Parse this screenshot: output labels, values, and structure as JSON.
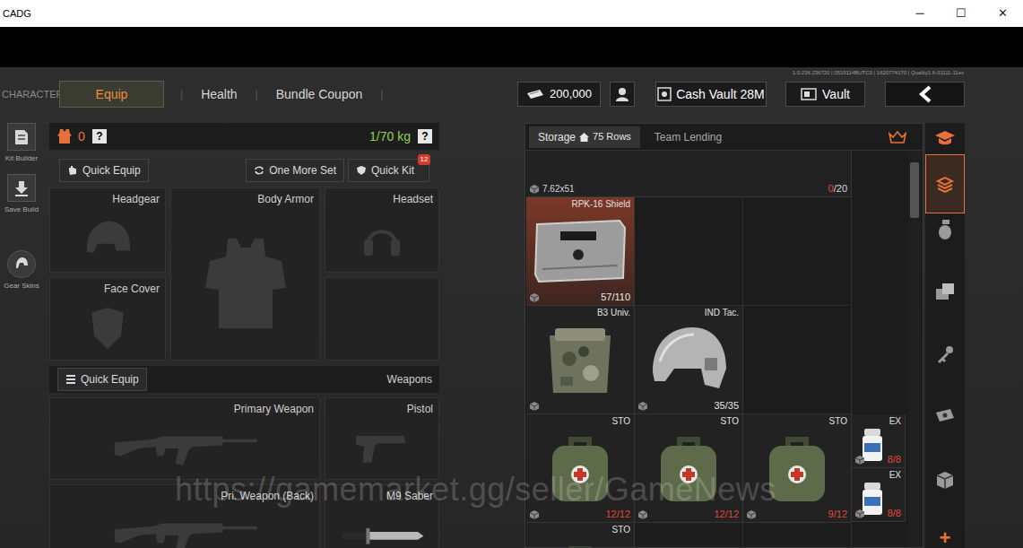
{
  "window": {
    "title": "CADG",
    "controls": [
      "─",
      "☐",
      "✕"
    ]
  },
  "build_info": "1.0.236.236720 | 0519114BUTC0 | 1620774170 | Quality1.6-01111-11ex",
  "nav": {
    "section": "CHARACTER",
    "separator": "|",
    "tabs": [
      {
        "label": "Equip",
        "selected": true
      },
      {
        "label": "Health",
        "selected": false
      },
      {
        "label": "Bundle Coupon",
        "selected": false
      }
    ]
  },
  "wallet": {
    "money": "200,000",
    "cash_vault": "Cash Vault 28M",
    "vault": "Vault"
  },
  "side_tools": [
    {
      "label": "Kit Builder",
      "kind": "kit"
    },
    {
      "label": "Save Build",
      "kind": "save"
    },
    {
      "label": "Gear Skins",
      "kind": "skins"
    }
  ],
  "loadout": {
    "armor_class": "0",
    "help": "?",
    "weight": "1/70 kg",
    "quick_equip": "Quick Equip",
    "one_more_set": "One More Set",
    "quick_kit": "Quick Kit",
    "quick_kit_badge": "12",
    "gear_slots": [
      {
        "label": "Headgear",
        "kind": "helmet"
      },
      {
        "label": "Body Armor",
        "kind": "armor"
      },
      {
        "label": "Headset",
        "kind": "headset"
      },
      {
        "label": "Face Cover",
        "kind": "face"
      }
    ],
    "weapons_quick_equip": "Quick Equip",
    "weapons_label": "Weapons",
    "weapon_slots": [
      {
        "label": "Primary Weapon",
        "kind": "rifle",
        "equipped": false
      },
      {
        "label": "Pistol",
        "kind": "pistol",
        "equipped": false
      },
      {
        "label": "Pri. Weapon (Back)",
        "kind": "rifle",
        "equipped": false
      },
      {
        "label": "M9 Saber",
        "kind": "knife",
        "equipped": true
      }
    ]
  },
  "storage": {
    "tabs": [
      {
        "label": "Storage",
        "count": "75 Rows",
        "selected": true
      },
      {
        "label": "Team Lending",
        "count": "",
        "selected": false
      }
    ],
    "scrollbar": {
      "offset": 0.03,
      "level": 0.14
    },
    "rows": [
      {
        "items": [
          {
            "label": "",
            "kind": "gun",
            "caliber": "7.62x51",
            "amount": "0",
            "capacity": "/20",
            "amount_color": "#e0483a",
            "capacity_color": "#d8d8d8",
            "slots": 3,
            "size": "large",
            "selected": false
          }
        ]
      },
      {
        "items": [
          {
            "label": "RPK-16 Shield",
            "kind": "shield",
            "caliber": "",
            "amount": "57",
            "capacity": "/110",
            "amount_color": "#e8e8e8",
            "capacity_color": "#e8e8e8",
            "slots": 1,
            "size": "large",
            "selected": true
          }
        ]
      },
      {
        "items": [
          {
            "label": "B3 Univ.",
            "kind": "pouch",
            "caliber": "",
            "amount": "",
            "capacity": "",
            "amount_color": "#e8e8e8",
            "capacity_color": "#e8e8e8",
            "slots": 1,
            "size": "large",
            "selected": false
          },
          {
            "label": "IND Tac.",
            "kind": "helmet",
            "caliber": "",
            "amount": "35",
            "capacity": "/35",
            "amount_color": "#e8e8e8",
            "capacity_color": "#e8e8e8",
            "slots": 1,
            "size": "large",
            "selected": false
          }
        ]
      },
      {
        "items": [
          {
            "label": "STO",
            "kind": "medbag",
            "caliber": "",
            "amount": "12",
            "capacity": "/12",
            "amount_color": "#e0483a",
            "capacity_color": "#e0483a",
            "slots": 1,
            "size": "large",
            "selected": false
          },
          {
            "label": "STO",
            "kind": "medbag",
            "caliber": "",
            "amount": "12",
            "capacity": "/12",
            "amount_color": "#e0483a",
            "capacity_color": "#e0483a",
            "slots": 1,
            "size": "large",
            "selected": false
          },
          {
            "label": "STO",
            "kind": "medbag",
            "caliber": "",
            "amount": "9",
            "capacity": "/12",
            "amount_color": "#e0483a",
            "capacity_color": "#e0483a",
            "slots": 1,
            "size": "large",
            "selected": false
          },
          {
            "label": "EX",
            "kind": "pills",
            "caliber": "",
            "amount": "8",
            "capacity": "/8",
            "amount_color": "#e0483a",
            "capacity_color": "#e0483a",
            "slots": 1,
            "size": "small",
            "selected": false
          },
          {
            "label": "EX",
            "kind": "pills",
            "caliber": "",
            "amount": "8",
            "capacity": "/8",
            "amount_color": "#e0483a",
            "capacity_color": "#e0483a",
            "slots": 1,
            "size": "small",
            "selected": false
          }
        ]
      },
      {
        "items": [
          {
            "label": "STO",
            "kind": "medbag",
            "caliber": "",
            "amount": "",
            "capacity": "",
            "amount_color": "#e8e8e8",
            "capacity_color": "#e8e8e8",
            "slots": 1,
            "size": "large",
            "selected": false
          }
        ]
      }
    ]
  },
  "categories": [
    {
      "kind": "sort",
      "selected": false
    },
    {
      "kind": "stash",
      "selected": true
    },
    {
      "kind": "grenade",
      "selected": false
    },
    {
      "kind": "ammo",
      "selected": false
    },
    {
      "kind": "key",
      "selected": false
    },
    {
      "kind": "cash",
      "selected": false
    },
    {
      "kind": "container",
      "selected": false
    }
  ],
  "add_button": "+",
  "watermark": "https://gamemarket.gg/seller/GameNews"
}
